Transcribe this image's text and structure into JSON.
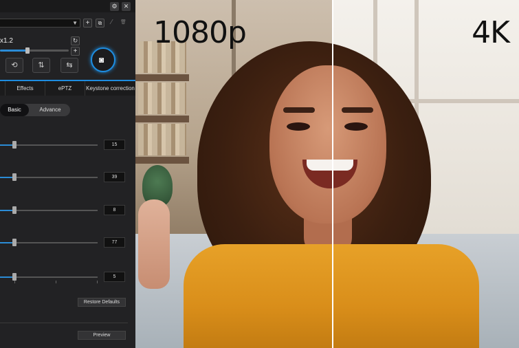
{
  "photo": {
    "label_left": "1080p",
    "label_right": "4K"
  },
  "window": {
    "settings_icon": "⚙",
    "close_icon": "✕"
  },
  "profile": {
    "selected": "",
    "add_icon": "+",
    "copy_icon": "⧉",
    "edit_icon": "⁄",
    "delete_icon": "🗑"
  },
  "zoom": {
    "label": "x1.2",
    "reset_icon": "↻",
    "plus_icon": "+",
    "level_fraction": 0.4
  },
  "tools": [
    "rotate-icon",
    "flip-vertical-icon",
    "mirror-icon"
  ],
  "capture": {
    "icon": "camera-icon"
  },
  "tabs": [
    {
      "label": ""
    },
    {
      "label": "Effects"
    },
    {
      "label": "ePTZ"
    },
    {
      "label": "Keystone correction"
    }
  ],
  "mode": {
    "basic": "Basic",
    "advance": "Advance"
  },
  "sliders": [
    {
      "value": "15",
      "fraction": 0.15
    },
    {
      "value": "39",
      "fraction": 0.15
    },
    {
      "value": "8",
      "fraction": 0.15
    },
    {
      "value": "77",
      "fraction": 0.15
    },
    {
      "value": "5",
      "fraction": 0.15
    }
  ],
  "buttons": {
    "restore_defaults": "Restore Defaults",
    "preview": "Preview"
  },
  "colors": {
    "accent": "#1e8de0",
    "panel_bg": "#222224",
    "hoodie": "#e7a128"
  }
}
